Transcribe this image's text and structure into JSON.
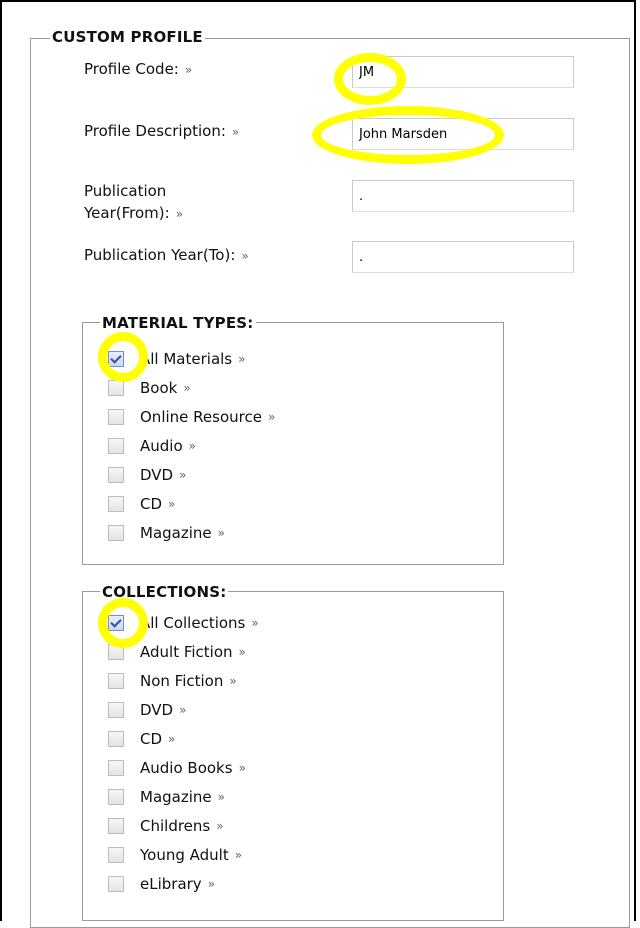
{
  "custom_profile": {
    "legend": "CUSTOM PROFILE",
    "fields": [
      {
        "label": "Profile Code:",
        "value": "JM"
      },
      {
        "label": "Profile Description:",
        "value": "John Marsden"
      },
      {
        "label": "Publication Year(From):",
        "value": "."
      },
      {
        "label": "Publication Year(To):",
        "value": "."
      }
    ],
    "arrow": "»"
  },
  "material_types": {
    "legend": "MATERIAL TYPES:",
    "items": [
      {
        "label": "All Materials",
        "checked": true
      },
      {
        "label": "Book",
        "checked": false
      },
      {
        "label": "Online Resource",
        "checked": false
      },
      {
        "label": "Audio",
        "checked": false
      },
      {
        "label": "DVD",
        "checked": false
      },
      {
        "label": "CD",
        "checked": false
      },
      {
        "label": "Magazine",
        "checked": false
      }
    ]
  },
  "collections": {
    "legend": "COLLECTIONS:",
    "items": [
      {
        "label": "All Collections",
        "checked": true
      },
      {
        "label": "Adult Fiction",
        "checked": false
      },
      {
        "label": "Non Fiction",
        "checked": false
      },
      {
        "label": "DVD",
        "checked": false
      },
      {
        "label": "CD",
        "checked": false
      },
      {
        "label": "Audio Books",
        "checked": false
      },
      {
        "label": "Magazine",
        "checked": false
      },
      {
        "label": "Childrens",
        "checked": false
      },
      {
        "label": "Young Adult",
        "checked": false
      },
      {
        "label": "eLibrary",
        "checked": false
      }
    ]
  },
  "colors": {
    "highlight": "#ffff00",
    "border": "#9a9a9a"
  }
}
